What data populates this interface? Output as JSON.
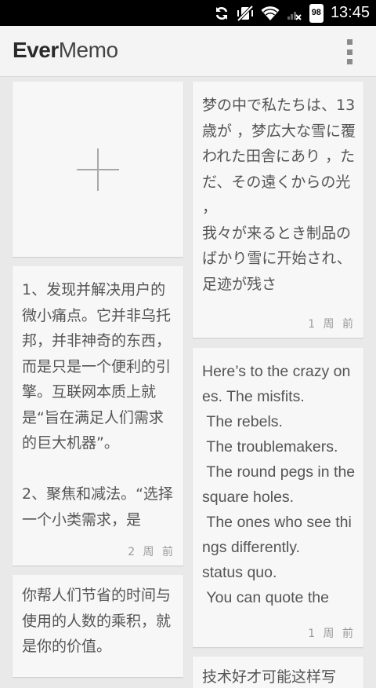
{
  "status_bar": {
    "battery": "98",
    "time": "13:45",
    "icons": [
      "sync-icon",
      "mute-vibrate-icon",
      "wifi-icon",
      "signal-no-service-icon",
      "battery-icon"
    ]
  },
  "app_bar": {
    "logo_ever": "Ever",
    "logo_memo": "Memo",
    "overflow_icon": "overflow-menu-icon"
  },
  "new_memo": {
    "icon": "plus-icon"
  },
  "memos": [
    {
      "text": "梦の中で私たちは、13歳が ，梦広大な雪に覆われた田舎にあり ，ただ、その遠くからの光 ，\n我々が来るとき制品のばかり雪に开始され、足迹が残さ",
      "age": "1 周 前"
    },
    {
      "text": "1、发现并解决用户的微小痛点。它并非乌托邦，并非神奇的东西，而是只是一个便利的引擎。互联网本质上就是“旨在满足人们需求的巨大机器”。\n\n2、聚焦和减法。“选择一个小类需求，是",
      "age": "2 周 前"
    },
    {
      "text": "Here’s to the crazy ones. The misfits.\n The rebels.\n The troublemakers.\n The round pegs in the square holes.\n The ones who see things differently.\nstatus quo.\n You can quote the",
      "age": "1 周 前"
    },
    {
      "text": "你帮人们节省的时间与使用的人数的乘积，就是你的价值。",
      "age": ""
    },
    {
      "text": "技术好才可能这样写",
      "age": ""
    }
  ]
}
